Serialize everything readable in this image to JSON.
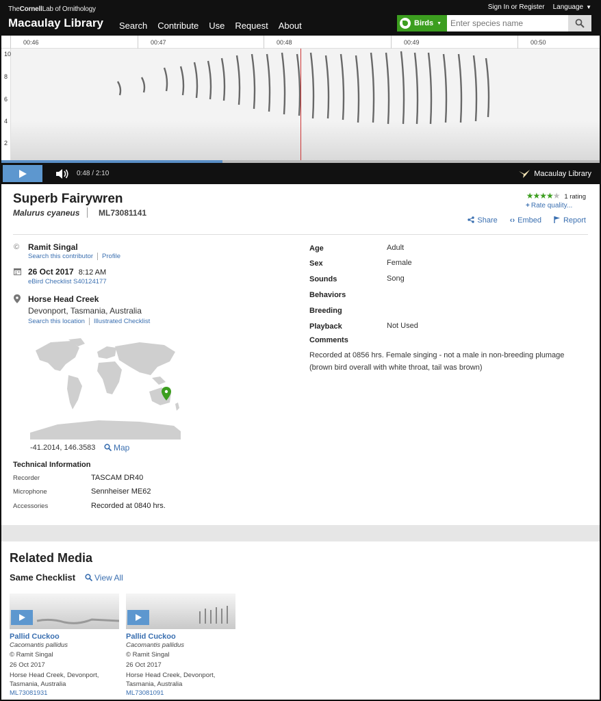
{
  "header": {
    "cornell_prefix": "The",
    "cornell_name": "Cornell",
    "cornell_suffix": "Lab of Ornithology",
    "brand": "Macaulay Library",
    "nav": [
      "Search",
      "Contribute",
      "Use",
      "Request",
      "About"
    ],
    "sign_in": "Sign In or Register",
    "language": "Language",
    "taxon_filter": "Birds",
    "search_placeholder": "Enter species name"
  },
  "player": {
    "timeline_ticks": [
      "00:46",
      "00:47",
      "00:48",
      "00:49",
      "00:50"
    ],
    "freq_labels": [
      "10",
      "8",
      "6",
      "4",
      "2"
    ],
    "current_time": "0:48",
    "time_separator": "/",
    "duration": "2:10",
    "progress_fraction": 0.369,
    "watermark": "Macaulay Library"
  },
  "species": {
    "common_name": "Superb Fairywren",
    "scientific_name": "Malurus cyaneus",
    "ml_id": "ML73081141",
    "rating_stars": 4,
    "rating_max": 5,
    "rating_count": "1 rating",
    "rate_link": "Rate quality..."
  },
  "actions": {
    "share": "Share",
    "embed": "Embed",
    "report": "Report"
  },
  "contributor": {
    "name": "Ramit Singal",
    "search_link": "Search this contributor",
    "profile_link": "Profile"
  },
  "date": {
    "date": "26 Oct 2017",
    "time": "8:12 AM",
    "checklist": "eBird Checklist S40124177"
  },
  "location": {
    "name": "Horse Head Creek",
    "region": "Devonport, Tasmania, Australia",
    "search_link": "Search this location",
    "checklist_link": "Illustrated Checklist",
    "coords": "-41.2014, 146.3583",
    "map_link": "Map"
  },
  "technical": {
    "title": "Technical Information",
    "rows": [
      {
        "label": "Recorder",
        "value": "TASCAM DR40"
      },
      {
        "label": "Microphone",
        "value": "Sennheiser ME62"
      },
      {
        "label": "Accessories",
        "value": "Recorded at 0840 hrs."
      }
    ]
  },
  "attributes": [
    {
      "label": "Age",
      "value": "Adult"
    },
    {
      "label": "Sex",
      "value": "Female"
    },
    {
      "label": "Sounds",
      "value": "Song"
    },
    {
      "label": "Behaviors",
      "value": ""
    },
    {
      "label": "Breeding",
      "value": ""
    },
    {
      "label": "Playback",
      "value": "Not Used"
    },
    {
      "label": "Comments",
      "value": ""
    }
  ],
  "comment_text": "Recorded at 0856 hrs. Female singing - not a male in non-breeding plumage (brown bird overall with white throat, tail was brown)",
  "related": {
    "title": "Related Media",
    "same_checklist": "Same Checklist",
    "view_all": "View All",
    "cards": [
      {
        "name": "Pallid Cuckoo",
        "sci": "Cacomantis pallidus",
        "contributor": "© Ramit Singal",
        "date": "26 Oct 2017",
        "loc1": "Horse Head Creek, Devonport,",
        "loc2": "Tasmania, Australia",
        "id": "ML73081931"
      },
      {
        "name": "Pallid Cuckoo",
        "sci": "Cacomantis pallidus",
        "contributor": "© Ramit Singal",
        "date": "26 Oct 2017",
        "loc1": "Horse Head Creek, Devonport,",
        "loc2": "Tasmania, Australia",
        "id": "ML73081091"
      }
    ]
  },
  "colors": {
    "accent_green": "#3c9e1f",
    "link_blue": "#3a6fb0",
    "play_blue": "#5d97cf",
    "header_black": "#111111"
  }
}
